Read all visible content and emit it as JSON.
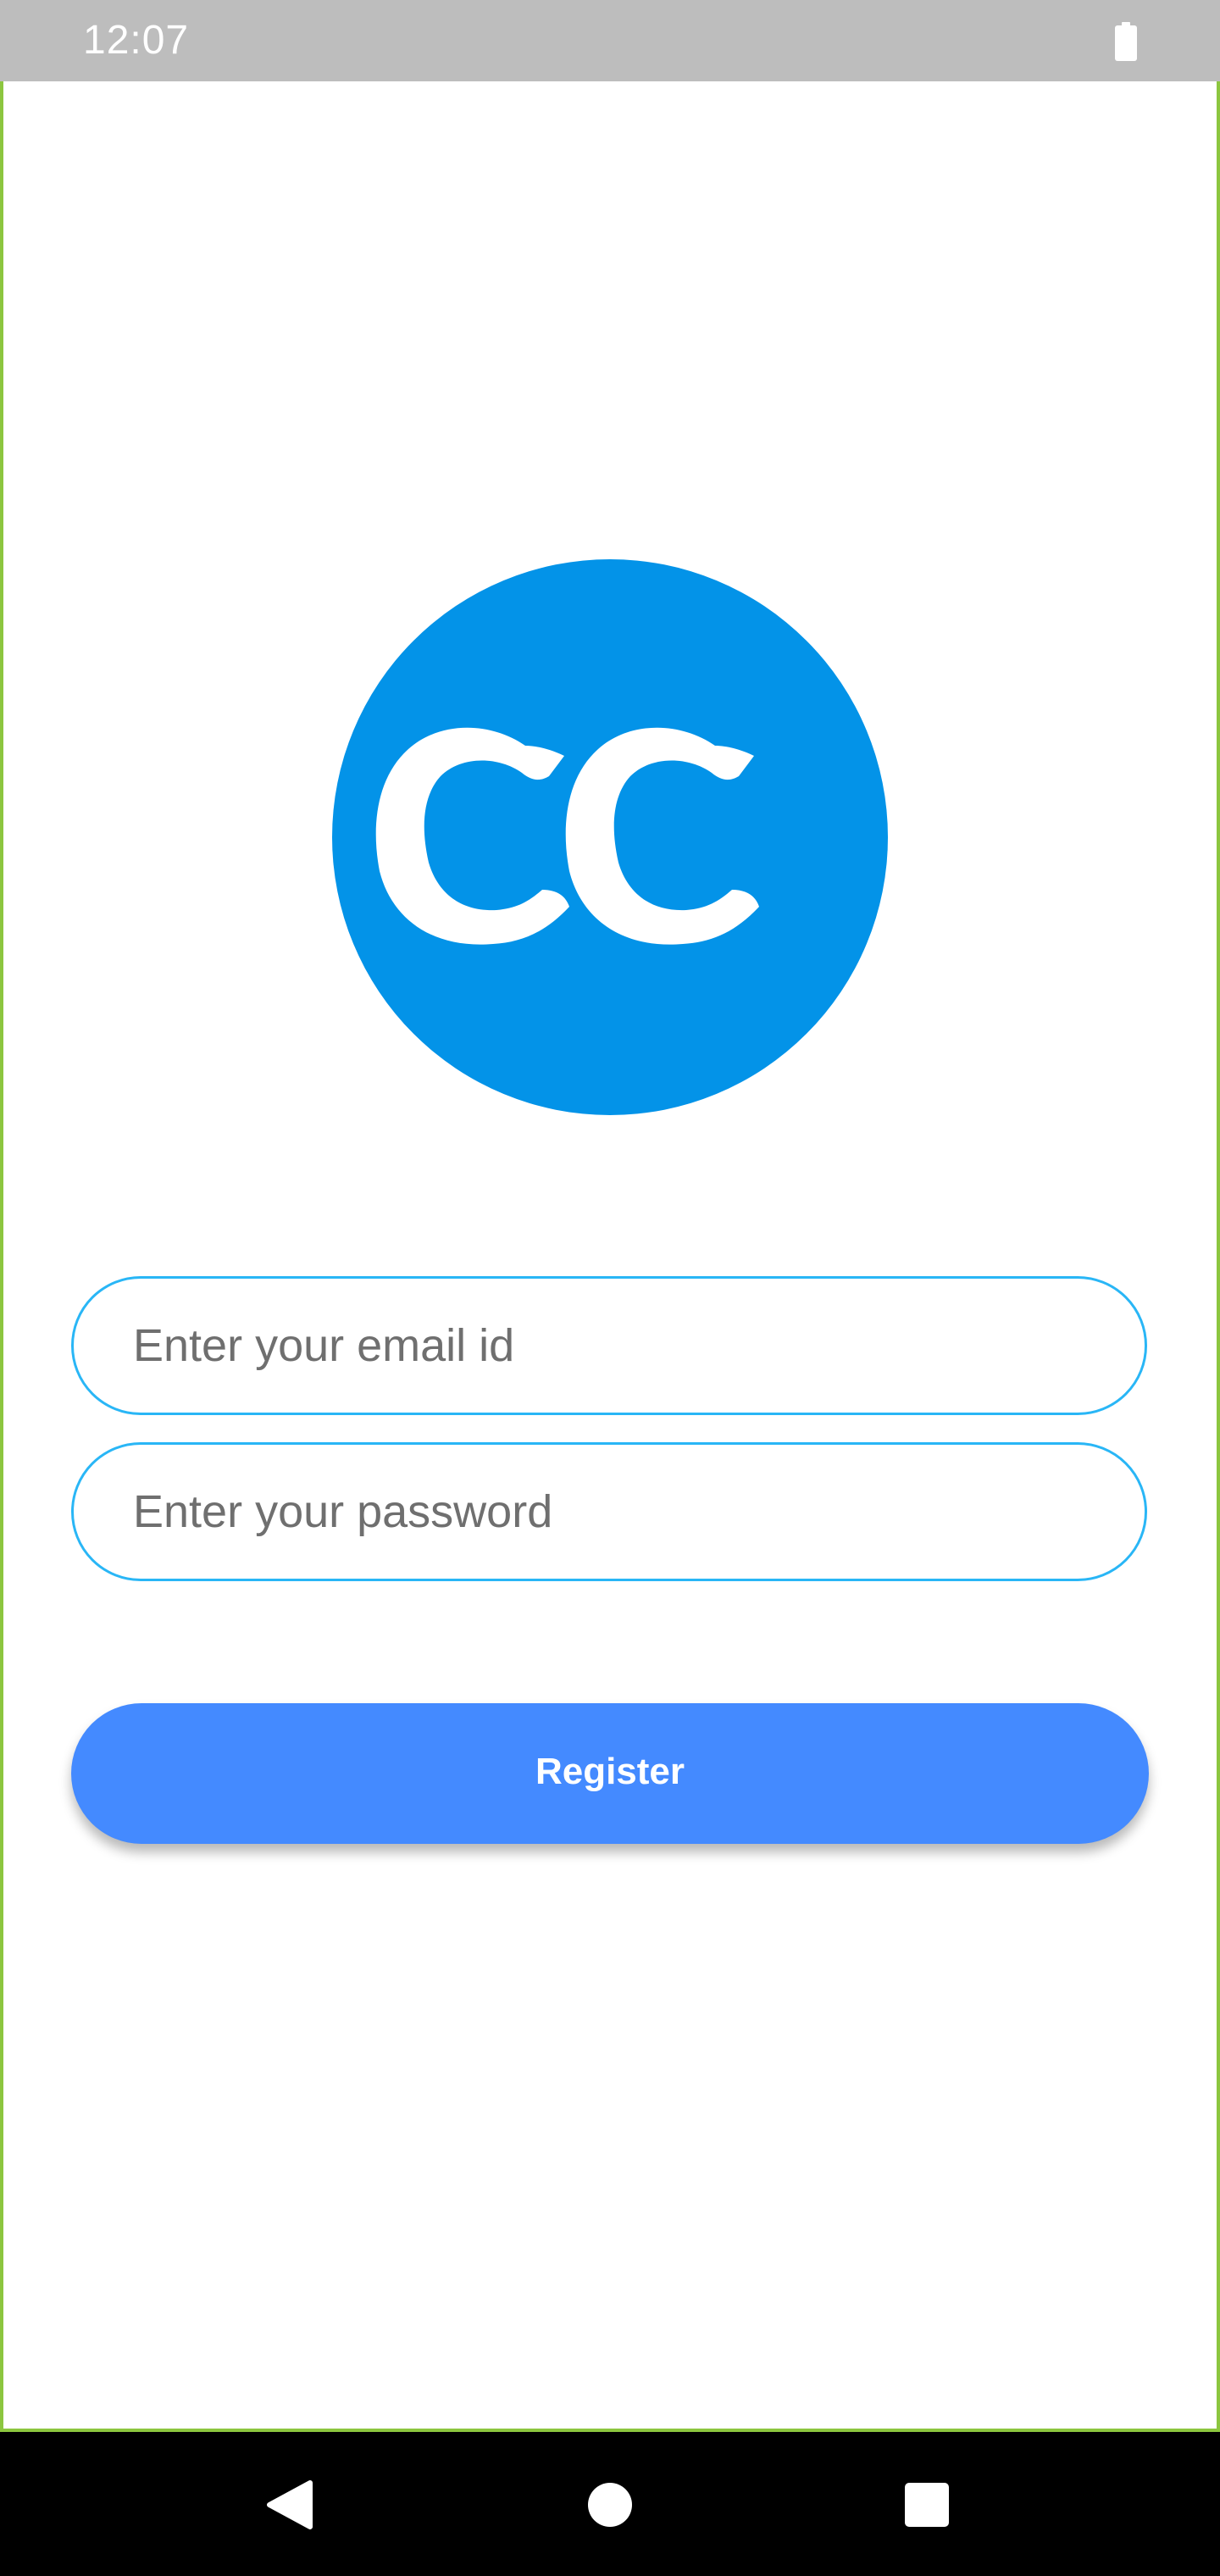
{
  "status_bar": {
    "time": "12:07",
    "icons": [
      "battery-icon"
    ]
  },
  "logo": {
    "text": "CC",
    "color": "#0393e8"
  },
  "form": {
    "email_placeholder": "Enter your email id",
    "password_placeholder": "Enter your password",
    "register_label": "Register"
  },
  "colors": {
    "field_border": "#29b6f6",
    "button": "#448aff",
    "frame_border": "#8cc63f"
  },
  "nav_bar": {
    "icons": [
      "back-icon",
      "home-icon",
      "recents-icon"
    ]
  }
}
